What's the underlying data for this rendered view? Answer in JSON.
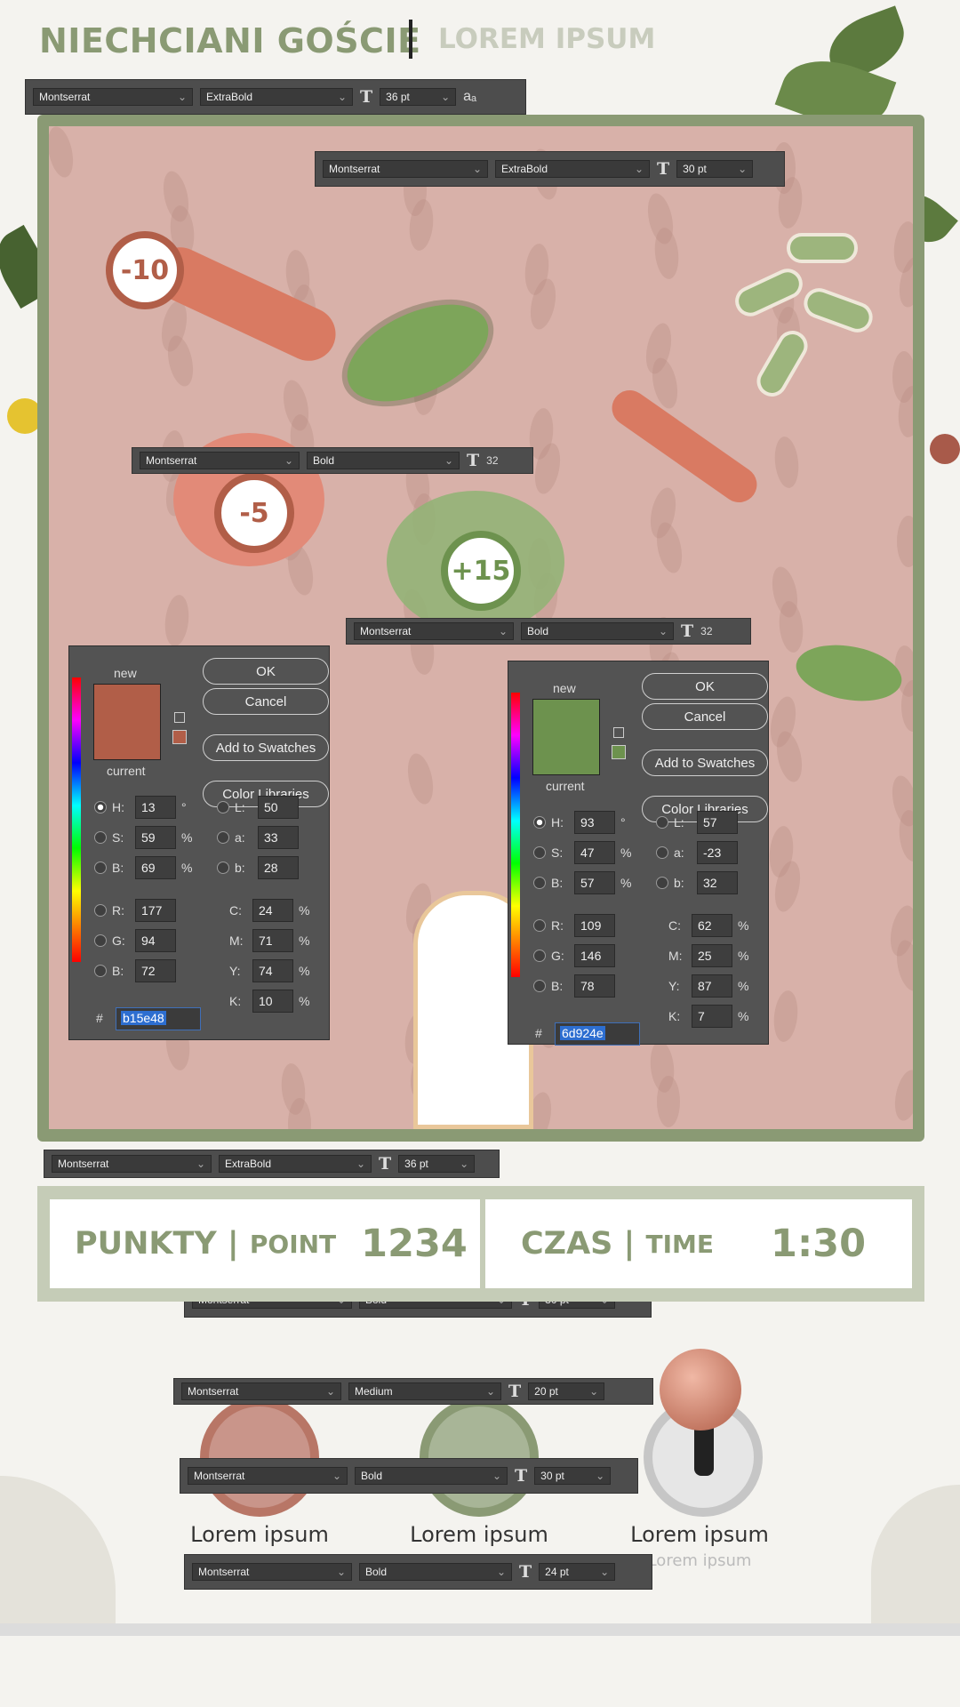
{
  "header": {
    "title": "NIECHCIANI GOŚCIE",
    "subtitle": "LOREM IPSUM"
  },
  "toolbars": [
    {
      "font": "Montserrat",
      "weight": "ExtraBold",
      "size": "36 pt",
      "extra": "aₐ"
    },
    {
      "font": "Montserrat",
      "weight": "ExtraBold",
      "size": "30 pt"
    },
    {
      "font": "Montserrat",
      "weight": "Bold",
      "size": "32"
    },
    {
      "font": "Montserrat",
      "weight": "Bold",
      "size": "32"
    },
    {
      "font": "Montserrat",
      "weight": "ExtraBold",
      "size": "36 pt"
    },
    {
      "font": "Montserrat",
      "weight": "Bold",
      "size": "30 pt"
    },
    {
      "font": "Montserrat",
      "weight": "Medium",
      "size": "20 pt"
    },
    {
      "font": "Montserrat",
      "weight": "Bold",
      "size": "30 pt"
    },
    {
      "font": "Montserrat",
      "weight": "Bold",
      "size": "24 pt"
    }
  ],
  "badges": [
    "-10",
    "-5",
    "+15"
  ],
  "picker_labels": {
    "new": "new",
    "current": "current",
    "ok": "OK",
    "cancel": "Cancel",
    "swatches": "Add to Swatches",
    "libraries": "Color Libraries",
    "hash": "#"
  },
  "pickers": [
    {
      "color": "#b15e48",
      "H": "13",
      "S": "59",
      "B": "69",
      "L": "50",
      "a": "33",
      "b": "28",
      "R": "177",
      "G": "94",
      "Bv": "72",
      "C": "24",
      "M": "71",
      "Y": "74",
      "K": "10",
      "hex": "b15e48"
    },
    {
      "color": "#6d924e",
      "H": "93",
      "S": "47",
      "B": "57",
      "L": "57",
      "a": "-23",
      "b": "32",
      "R": "109",
      "G": "146",
      "Bv": "78",
      "C": "62",
      "M": "25",
      "Y": "87",
      "K": "7",
      "hex": "6d924e"
    }
  ],
  "units": {
    "deg": "°",
    "pct": "%"
  },
  "fieldlabels": {
    "H": "H:",
    "S": "S:",
    "B": "B:",
    "L": "L:",
    "a": "a:",
    "b": "b:",
    "R": "R:",
    "G": "G:",
    "Bl": "B:",
    "C": "C:",
    "M": "M:",
    "Y": "Y:",
    "K": "K:"
  },
  "score": {
    "points_label": "PUNKTY |",
    "points_en": "POINT",
    "points_value": "1234",
    "time_label": "CZAS |",
    "time_en": "TIME",
    "time_value": "1:30"
  },
  "buttons": {
    "label1": "Lorem ipsum",
    "label2": "Lorem ipsum",
    "label3": "Lorem ipsum",
    "sublabel3": "Lorem ipsum"
  },
  "colors": {
    "green": "#8a9a74",
    "red": "#b15e48",
    "greenPick": "#6d924e"
  }
}
